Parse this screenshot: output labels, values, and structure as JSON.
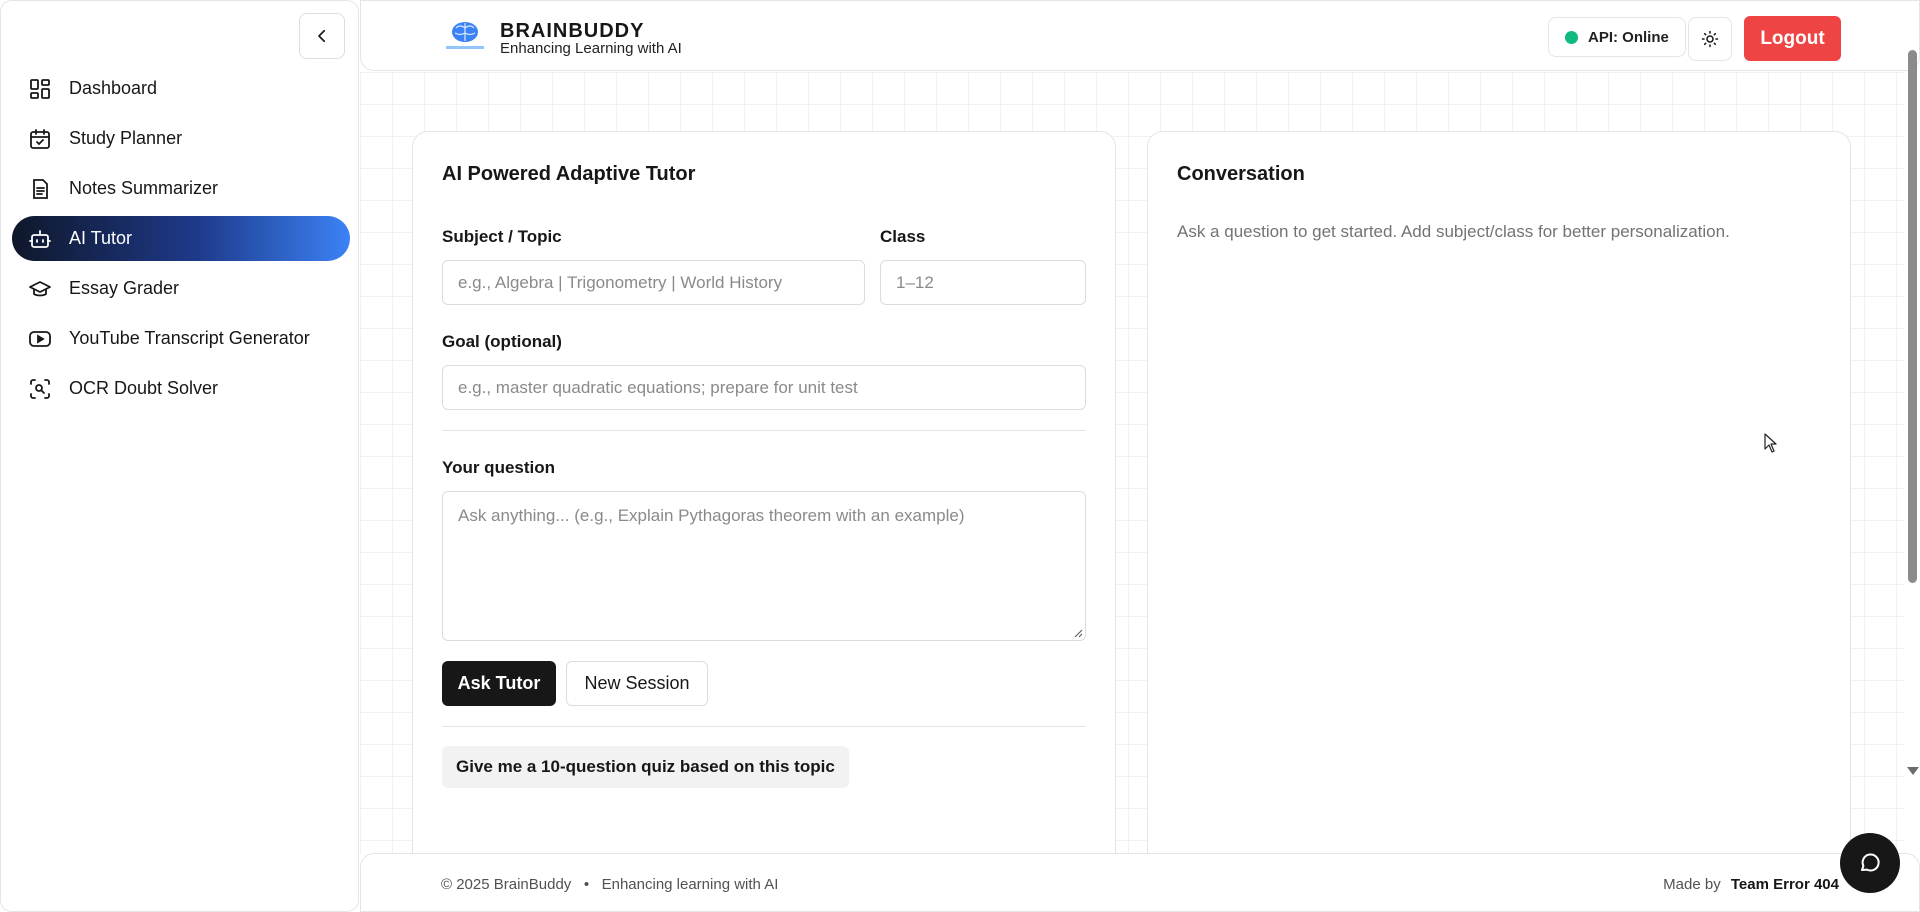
{
  "sidebar": {
    "items": [
      {
        "label": "Dashboard",
        "icon": "grid-icon",
        "active": false
      },
      {
        "label": "Study Planner",
        "icon": "calendar-check-icon",
        "active": false
      },
      {
        "label": "Notes Summarizer",
        "icon": "document-icon",
        "active": false
      },
      {
        "label": "AI Tutor",
        "icon": "robot-icon",
        "active": true
      },
      {
        "label": "Essay Grader",
        "icon": "graduation-cap-icon",
        "active": false
      },
      {
        "label": "YouTube Transcript Generator",
        "icon": "youtube-icon",
        "active": false
      },
      {
        "label": "OCR Doubt Solver",
        "icon": "scan-search-icon",
        "active": false
      }
    ],
    "collapse_icon": "chevron-left-icon"
  },
  "header": {
    "brand_name": "BRAINBUDDY",
    "brand_tagline": "Enhancing Learning with AI",
    "api_status": "API: Online",
    "status_color": "#10b981",
    "theme_icon": "sun-icon",
    "logout_label": "Logout",
    "logout_color": "#ef4444"
  },
  "tutor": {
    "title": "AI Powered Adaptive Tutor",
    "subject_label": "Subject / Topic",
    "subject_placeholder": "e.g., Algebra | Trigonometry | World History",
    "class_label": "Class",
    "class_placeholder": "1–12",
    "goal_label": "Goal (optional)",
    "goal_placeholder": "e.g., master quadratic equations; prepare for unit test",
    "question_label": "Your question",
    "question_placeholder": "Ask anything... (e.g., Explain Pythagoras theorem with an example)",
    "ask_button": "Ask Tutor",
    "new_session_button": "New Session",
    "suggestion_chip": "Give me a 10-question quiz based on this topic"
  },
  "conversation": {
    "title": "Conversation",
    "empty_hint": "Ask a question to get started. Add subject/class for better personalization."
  },
  "footer": {
    "copyright": "© 2025 BrainBuddy",
    "separator": "•",
    "tagline": "Enhancing learning with AI",
    "made_by_label": "Made by",
    "team_name": "Team Error 404"
  },
  "chat_fab_icon": "message-circle-icon"
}
